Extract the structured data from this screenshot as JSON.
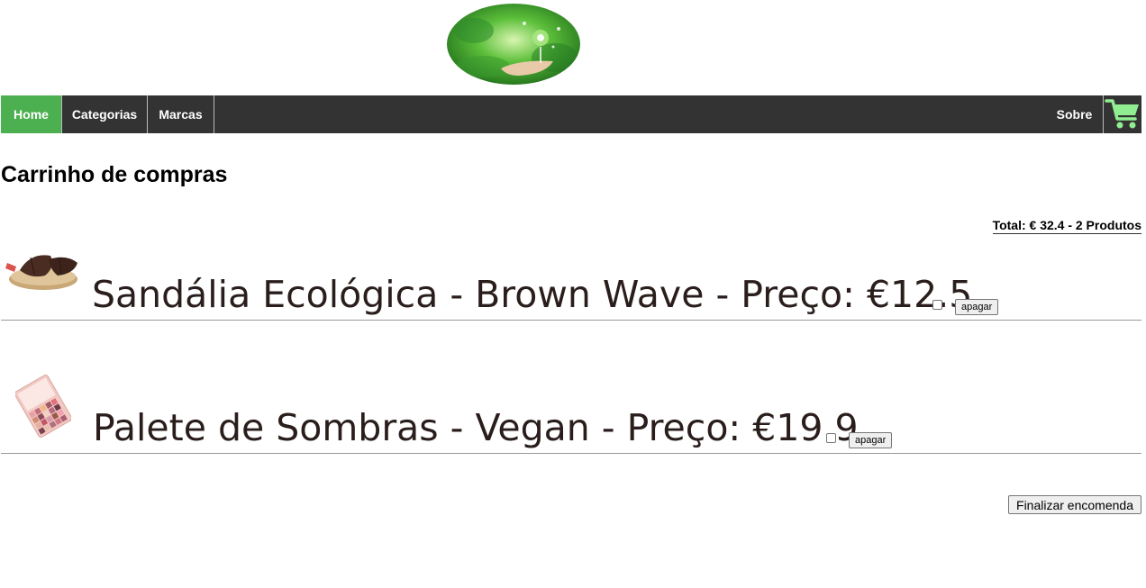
{
  "nav": {
    "home": "Home",
    "categorias": "Categorias",
    "marcas": "Marcas",
    "sobre": "Sobre"
  },
  "page": {
    "title": "Carrinho de compras",
    "total": "Total: € 32.4 - 2 Produtos"
  },
  "items": [
    {
      "text": "Sandália Ecológica - Brown Wave - Preço: €12.5",
      "delete_label": "apagar",
      "image": "sandal-product-image"
    },
    {
      "text": "Palete de Sombras - Vegan - Preço: €19.9",
      "delete_label": "apagar",
      "image": "eyeshadow-palette-product-image"
    }
  ],
  "checkout": {
    "label": "Finalizar encomenda"
  },
  "colors": {
    "nav_bg": "#333333",
    "nav_active": "#4caf50",
    "cart_icon": "#90ee90",
    "item_text": "#2a1e1c"
  },
  "icons": {
    "logo": "eco-leaf-hand-logo",
    "cart": "shopping-cart-icon"
  }
}
